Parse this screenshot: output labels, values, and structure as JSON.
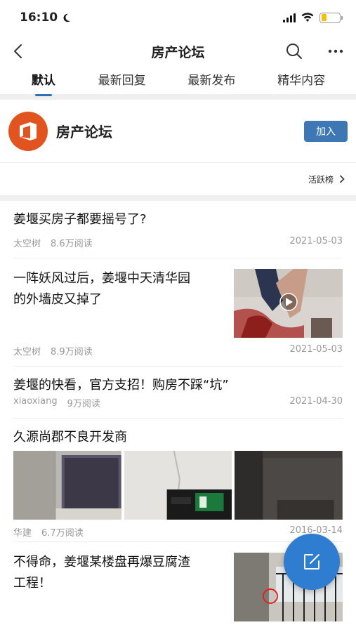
{
  "status": {
    "time": "16:10"
  },
  "nav": {
    "title": "房产论坛"
  },
  "tabs": [
    {
      "label": "默认"
    },
    {
      "label": "最新回复"
    },
    {
      "label": "最新发布"
    },
    {
      "label": "精华内容"
    }
  ],
  "forum": {
    "name": "房产论坛",
    "join_label": "加入",
    "active_rank_label": "活跃榜"
  },
  "posts": [
    {
      "title": "姜堰买房子都要摇号了?",
      "author": "太空树",
      "reads": "8.6万阅读",
      "date": "2021-05-03"
    },
    {
      "title_line1": "一阵妖风过后，姜堰中天清华园",
      "title_line2": "的外墙皮又掉了",
      "author": "太空树",
      "reads": "8.9万阅读",
      "date": "2021-05-03"
    },
    {
      "title": "姜堰的快看，官方支招！购房不踩“坑”",
      "author": "xiaoxiang",
      "reads": "9万阅读",
      "date": "2021-04-30"
    },
    {
      "title": "久源尚郡不良开发商",
      "author": "华建",
      "reads": "6.7万阅读",
      "date": "2016-03-14"
    },
    {
      "title_line1": "不得命，姜堰某楼盘再爆豆腐渣",
      "title_line2": "工程！"
    }
  ],
  "colors": {
    "accent": "#3d78b5",
    "fab": "#2f7dd0",
    "logo": "#e2541f"
  }
}
